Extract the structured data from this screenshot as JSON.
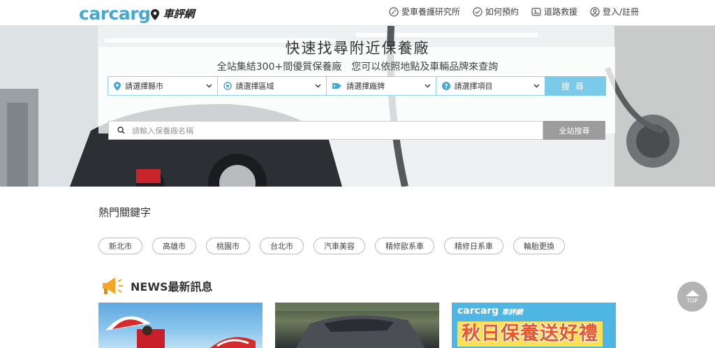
{
  "header": {
    "logo_text": "carcarg",
    "logo_cn": "車評網",
    "nav": [
      {
        "label": "愛車養護研究所",
        "icon": "wrench-icon"
      },
      {
        "label": "如何預約",
        "icon": "check-circle-icon"
      },
      {
        "label": "道路救援",
        "icon": "tow-truck-icon"
      },
      {
        "label": "登入/註冊",
        "icon": "user-icon"
      }
    ]
  },
  "hero": {
    "title": "快速找尋附近保養廠",
    "subtitle": "全站集結300+間優質保養廠　您可以依照地點及車輛品牌來查詢",
    "filters": [
      {
        "label": "請選擇縣市",
        "icon": "map-pin-icon"
      },
      {
        "label": "請選擇區域",
        "icon": "target-icon"
      },
      {
        "label": "請選擇廠牌",
        "icon": "tag-icon"
      },
      {
        "label": "請選擇項目",
        "icon": "question-circle-icon"
      }
    ],
    "search_label": "搜尋",
    "keyword_placeholder": "請輸入保養廠名稱",
    "site_search_label": "全站搜尋"
  },
  "hot": {
    "title": "熱門關鍵字",
    "tags": [
      "新北市",
      "高雄市",
      "桃園市",
      "台北市",
      "汽車美容",
      "精修歐系車",
      "精修日系車",
      "輪胎更換"
    ]
  },
  "news": {
    "title": "NEWS最新訊息",
    "cards": [
      {
        "alt": ""
      },
      {
        "alt": ""
      },
      {
        "logo": "carcarg",
        "logo_cn": "車評網",
        "banner": "秋日保養送好禮"
      }
    ]
  },
  "top_button": {
    "label": "TOP"
  },
  "colors": {
    "brand": "#41a9d6",
    "search_button": "#7ccaea",
    "site_search": "#9c9c9c"
  }
}
